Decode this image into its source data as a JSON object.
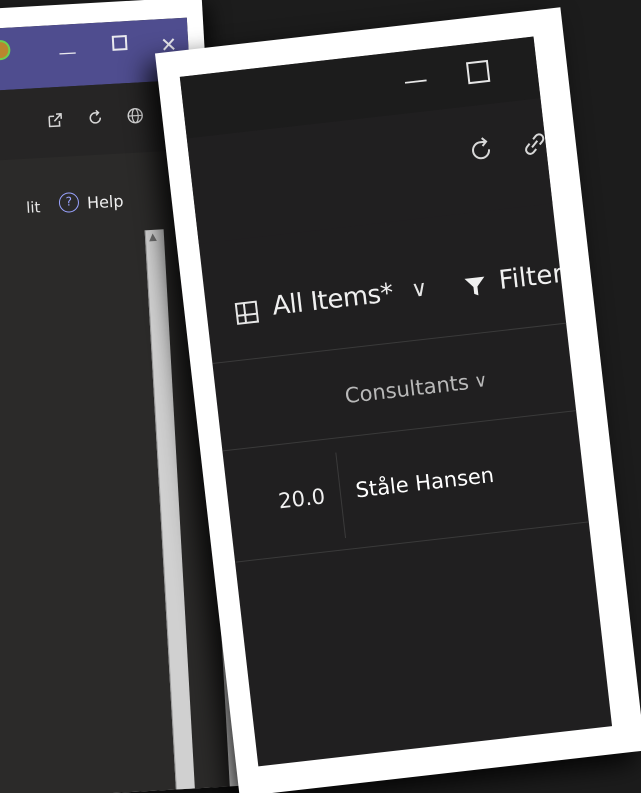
{
  "back_window": {
    "title_controls": {
      "minimize": "—",
      "close": "✕"
    },
    "toolbar_icons": [
      "open-external-icon",
      "refresh-icon",
      "globe-icon"
    ],
    "command_bar": {
      "edit_fragment": "lit",
      "help_label": "Help"
    },
    "scrollbar": {
      "up_arrow": "▲"
    }
  },
  "front_window": {
    "title_controls": {
      "minimize": "—"
    },
    "toolbar_icons": [
      "refresh-icon",
      "link-icon"
    ],
    "view_bar": {
      "view_name": "All Items*",
      "view_chevron": "∨",
      "filter_label": "Filter"
    },
    "table": {
      "columns": [
        {
          "label": "Consultants",
          "chevron": "∨"
        }
      ],
      "rows": [
        {
          "number": "20.0",
          "consultant": "Ståle Hansen"
        }
      ]
    }
  },
  "colors": {
    "back_titlebar": "#4f4d8f",
    "front_background": "#201f20",
    "help_accent": "#9aa3ff",
    "card_border": "#ffffff"
  }
}
